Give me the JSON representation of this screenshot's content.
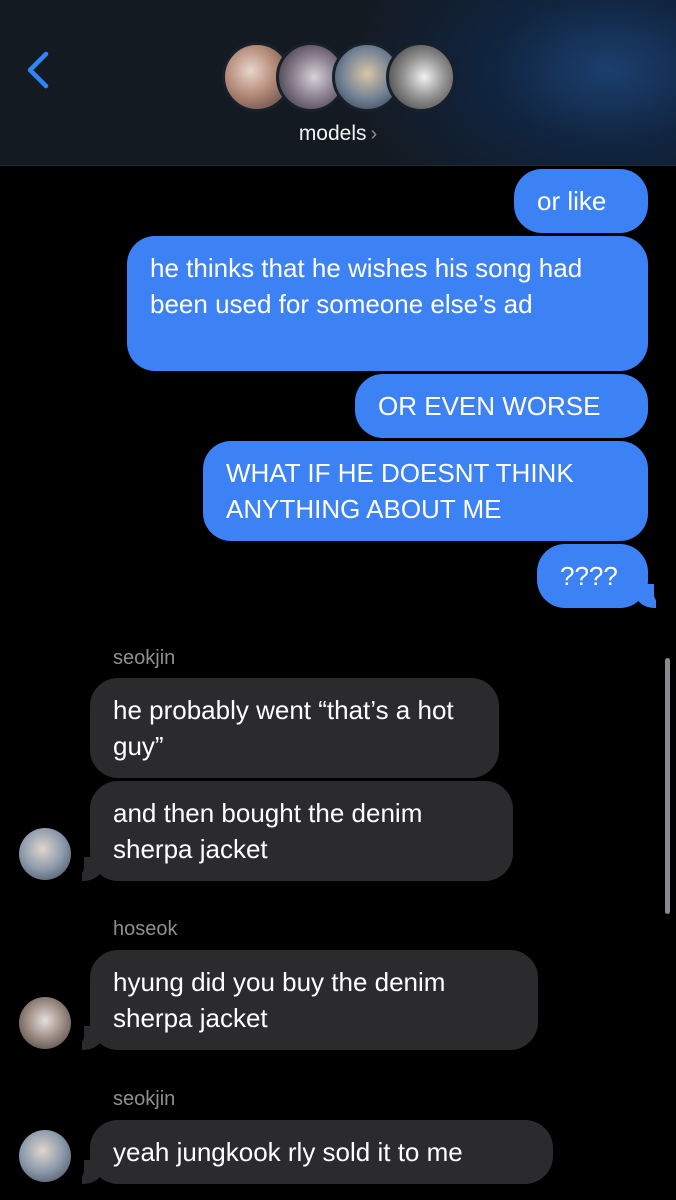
{
  "header": {
    "back_icon": "chevron-left-icon",
    "group_name": "models",
    "chevron": "›",
    "accent": "#2f86f6"
  },
  "messages": [
    {
      "from": "me",
      "text": "or like"
    },
    {
      "from": "me",
      "text": "he thinks that he wishes his song had been used for someone else’s ad"
    },
    {
      "from": "me",
      "text": "OR EVEN WORSE"
    },
    {
      "from": "me",
      "text": "WHAT IF HE DOESNT THINK ANYTHING ABOUT ME"
    },
    {
      "from": "me",
      "text": "????"
    },
    {
      "sender": "seokjin",
      "text": "he probably went “that’s a hot guy”"
    },
    {
      "sender": "seokjin",
      "text": "and then bought the denim sherpa jacket"
    },
    {
      "sender": "hoseok",
      "text": "hyung did you buy the denim sherpa jacket"
    },
    {
      "sender": "seokjin",
      "text": "yeah jungkook rly sold it to me"
    }
  ],
  "colors": {
    "outgoing_bubble": "#3d82f5",
    "incoming_bubble": "#2b2b2e",
    "background": "#000000",
    "sender_label": "#8e8e93"
  }
}
